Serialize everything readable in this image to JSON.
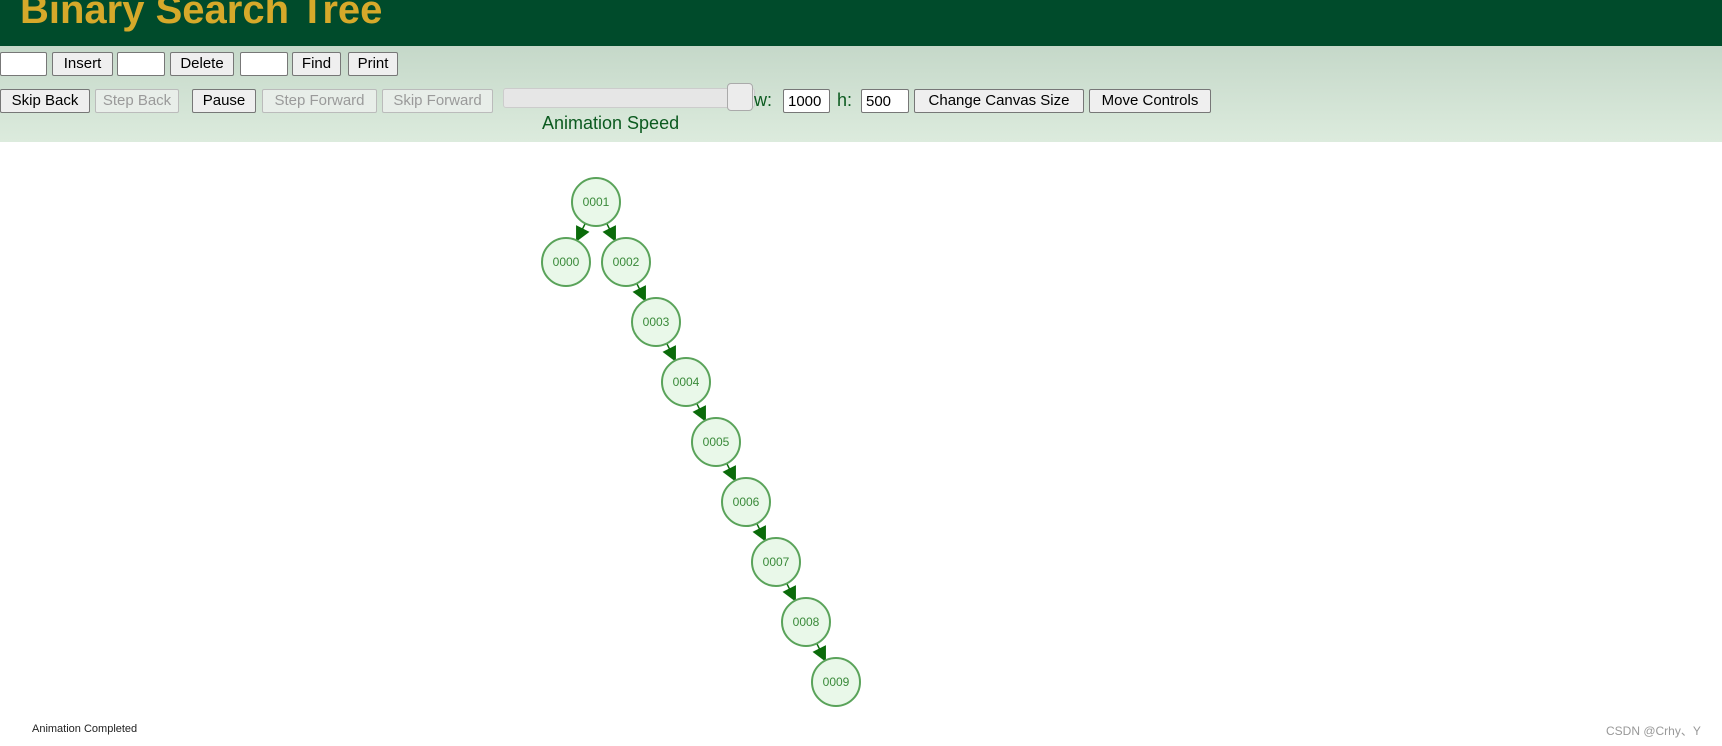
{
  "header": {
    "title": "Binary Search Tree"
  },
  "toolbar": {
    "insert_value": "",
    "insert_label": "Insert",
    "delete_value": "",
    "delete_label": "Delete",
    "find_value": "",
    "find_label": "Find",
    "print_label": "Print",
    "skip_back": "Skip Back",
    "step_back": "Step Back",
    "pause": "Pause",
    "step_forward": "Step Forward",
    "skip_forward": "Skip Forward",
    "animation_speed_label": "Animation Speed",
    "animation_speed_percent": 95,
    "w_label": "w:",
    "w_value": "1000",
    "h_label": "h:",
    "h_value": "500",
    "change_canvas": "Change Canvas Size",
    "move_controls": "Move Controls"
  },
  "tree": {
    "nodes": [
      {
        "key": "0001",
        "parent": null,
        "side": null
      },
      {
        "key": "0000",
        "parent": "0001",
        "side": "left"
      },
      {
        "key": "0002",
        "parent": "0001",
        "side": "right"
      },
      {
        "key": "0003",
        "parent": "0002",
        "side": "right"
      },
      {
        "key": "0004",
        "parent": "0003",
        "side": "right"
      },
      {
        "key": "0005",
        "parent": "0004",
        "side": "right"
      },
      {
        "key": "0006",
        "parent": "0005",
        "side": "right"
      },
      {
        "key": "0007",
        "parent": "0006",
        "side": "right"
      },
      {
        "key": "0008",
        "parent": "0007",
        "side": "right"
      },
      {
        "key": "0009",
        "parent": "0008",
        "side": "right"
      }
    ],
    "colors": {
      "fill": "#e9f8e9",
      "stroke": "#5aa35a",
      "text": "#3a8a3a",
      "edge": "#0a6b0a"
    }
  },
  "status": "Animation Completed",
  "watermark": "CSDN @Crhy、Y"
}
